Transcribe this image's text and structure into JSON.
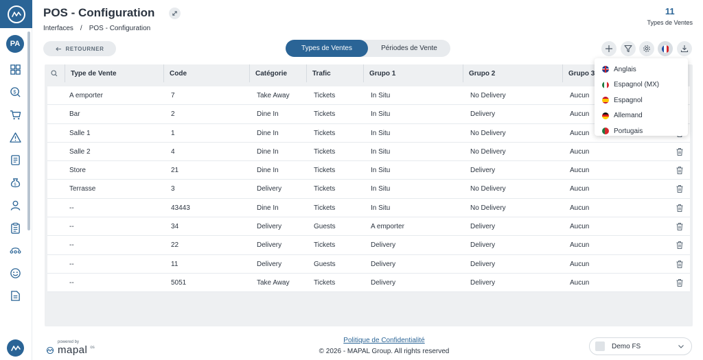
{
  "app": {
    "title": "POS - Configuration"
  },
  "breadcrumb": {
    "root": "Interfaces",
    "sep": "/",
    "current": "POS - Configuration"
  },
  "counter": {
    "value": "11",
    "label": "Types de Ventes"
  },
  "user": {
    "initials": "PA"
  },
  "toolbar": {
    "back_label": "RETOURNER",
    "tab_active": "Types de Ventes",
    "tab_inactive": "Périodes de Vente"
  },
  "table": {
    "columns": [
      "Type de Vente",
      "Code",
      "Catégorie",
      "Trafic",
      "Grupo 1",
      "Grupo 2",
      "Grupo 3"
    ],
    "rows": [
      [
        "A emporter",
        "7",
        "Take Away",
        "Tickets",
        "In Situ",
        "No Delivery",
        "Aucun"
      ],
      [
        "Bar",
        "2",
        "Dine In",
        "Tickets",
        "In Situ",
        "Delivery",
        "Aucun"
      ],
      [
        "Salle 1",
        "1",
        "Dine In",
        "Tickets",
        "In Situ",
        "No Delivery",
        "Aucun"
      ],
      [
        "Salle 2",
        "4",
        "Dine In",
        "Tickets",
        "In Situ",
        "No Delivery",
        "Aucun"
      ],
      [
        "Store",
        "21",
        "Dine In",
        "Tickets",
        "In Situ",
        "Delivery",
        "Aucun"
      ],
      [
        "Terrasse",
        "3",
        "Delivery",
        "Tickets",
        "In Situ",
        "No Delivery",
        "Aucun"
      ],
      [
        "--",
        "43443",
        "Dine In",
        "Tickets",
        "In Situ",
        "No Delivery",
        "Aucun"
      ],
      [
        "--",
        "34",
        "Delivery",
        "Guests",
        "A emporter",
        "Delivery",
        "Aucun"
      ],
      [
        "--",
        "22",
        "Delivery",
        "Tickets",
        "Delivery",
        "Delivery",
        "Aucun"
      ],
      [
        "--",
        "11",
        "Delivery",
        "Guests",
        "Delivery",
        "Delivery",
        "Aucun"
      ],
      [
        "--",
        "5051",
        "Take Away",
        "Tickets",
        "Delivery",
        "Delivery",
        "Aucun"
      ]
    ]
  },
  "languages": [
    {
      "label": "Anglais",
      "flag": "uk"
    },
    {
      "label": "Espagnol (MX)",
      "flag": "mx"
    },
    {
      "label": "Espagnol",
      "flag": "es"
    },
    {
      "label": "Allemand",
      "flag": "de"
    },
    {
      "label": "Portugais",
      "flag": "pt"
    }
  ],
  "footer": {
    "powered": "powered by",
    "brand": "mapal",
    "brand_sup": "os",
    "privacy": "Politique de Confidentialité",
    "copyright": "© 2026 - MAPAL Group. All rights reserved",
    "venue": "Demo FS"
  },
  "colors": {
    "accent": "#2a6496",
    "background_panel": "#eef0f2",
    "pill_bg": "#e8ebee"
  },
  "icons": {
    "sidebar": [
      "dashboard-icon",
      "money-search-icon",
      "cart-icon",
      "warning-icon",
      "report-icon",
      "money-bag-icon",
      "person-icon",
      "clipboard-icon",
      "pipeline-icon",
      "smiley-icon",
      "document-icon"
    ],
    "toolbar": [
      "plus-icon",
      "filter-icon",
      "gear-icon",
      "france-flag-icon",
      "download-icon"
    ]
  }
}
